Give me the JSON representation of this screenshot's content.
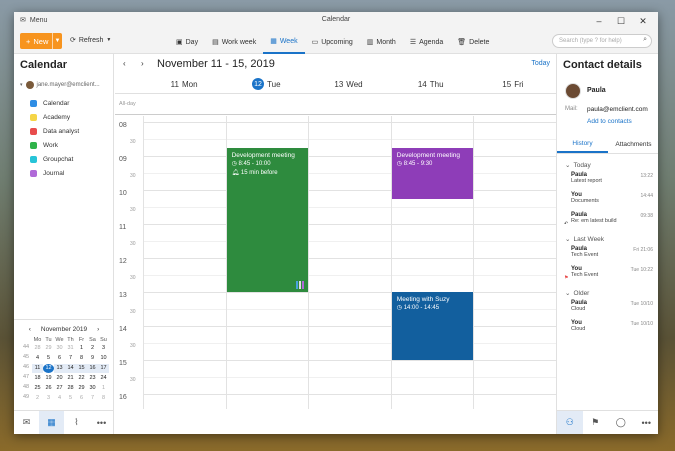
{
  "window": {
    "menu_label": "Menu",
    "title": "Calendar"
  },
  "toolbar": {
    "new_label": "New",
    "refresh_label": "Refresh",
    "views": [
      {
        "label": "Day",
        "icon": "calendar-day-icon",
        "active": false
      },
      {
        "label": "Work week",
        "icon": "calendar-workweek-icon",
        "active": false
      },
      {
        "label": "Week",
        "icon": "calendar-week-icon",
        "active": true
      },
      {
        "label": "Upcoming",
        "icon": "calendar-upcoming-icon",
        "active": false
      },
      {
        "label": "Month",
        "icon": "calendar-month-icon",
        "active": false
      },
      {
        "label": "Agenda",
        "icon": "agenda-icon",
        "active": false
      },
      {
        "label": "Delete",
        "icon": "trash-icon",
        "active": false
      }
    ],
    "search_placeholder": "Search (type ? for help)"
  },
  "sidebar": {
    "title": "Calendar",
    "account": "jane.mayer@emclient...",
    "calendars": [
      {
        "label": "Calendar",
        "color": "#2f8de4"
      },
      {
        "label": "Academy",
        "color": "#f5d547"
      },
      {
        "label": "Data analyst",
        "color": "#e84c4c"
      },
      {
        "label": "Work",
        "color": "#2fb34a"
      },
      {
        "label": "Groupchat",
        "color": "#27c4d8"
      },
      {
        "label": "Journal",
        "color": "#b06ad8"
      }
    ],
    "mini_calendar": {
      "month": "November 2019",
      "day_headers": [
        "Mo",
        "Tu",
        "We",
        "Th",
        "Fr",
        "Sa",
        "Su"
      ],
      "weeks": [
        {
          "wk": "44",
          "days": [
            "28",
            "29",
            "30",
            "31",
            "1",
            "2",
            "3"
          ]
        },
        {
          "wk": "45",
          "days": [
            "4",
            "5",
            "6",
            "7",
            "8",
            "9",
            "10"
          ]
        },
        {
          "wk": "46",
          "days": [
            "11",
            "12",
            "13",
            "14",
            "15",
            "16",
            "17"
          ]
        },
        {
          "wk": "47",
          "days": [
            "18",
            "19",
            "20",
            "21",
            "22",
            "23",
            "24"
          ]
        },
        {
          "wk": "48",
          "days": [
            "25",
            "26",
            "27",
            "28",
            "29",
            "30",
            "1"
          ]
        },
        {
          "wk": "49",
          "days": [
            "2",
            "3",
            "4",
            "5",
            "6",
            "7",
            "8"
          ]
        }
      ],
      "today": "12"
    }
  },
  "calendar": {
    "range_title": "November 11 - 15, 2019",
    "today_label": "Today",
    "all_day_label": "All-day",
    "days": [
      {
        "num": "11",
        "name": "Mon",
        "today": false
      },
      {
        "num": "12",
        "name": "Tue",
        "today": true
      },
      {
        "num": "13",
        "name": "Wed",
        "today": false
      },
      {
        "num": "14",
        "name": "Thu",
        "today": false
      },
      {
        "num": "15",
        "name": "Fri",
        "today": false
      }
    ],
    "hours": [
      "08",
      "09",
      "10",
      "11",
      "12",
      "13",
      "14",
      "15",
      "16"
    ],
    "half_label": "30",
    "events": [
      {
        "title": "Development meeting",
        "time": "8:45 - 10:00",
        "reminder": "15 min before",
        "color": "#2e8b3e",
        "day": 1,
        "start": 8.75,
        "end": 13.0,
        "tags": [
          "#4aa3df",
          "#e0e0e0",
          "#b06ad8"
        ]
      },
      {
        "title": "Development meeting",
        "time": "8:45 - 9:30",
        "reminder": "",
        "color": "#8e3db8",
        "day": 3,
        "start": 8.75,
        "end": 10.25,
        "tags": []
      },
      {
        "title": "Meeting with Suzy",
        "time": "14:00 - 14:45",
        "reminder": "",
        "color": "#125f9e",
        "day": 3,
        "start": 13.0,
        "end": 15.0,
        "tags": []
      }
    ]
  },
  "contact": {
    "title": "Contact details",
    "name": "Paula",
    "mail_label": "Mail:",
    "mail": "paula@emclient.com",
    "add_label": "Add to contacts",
    "tabs": [
      "History",
      "Attachments"
    ],
    "groups": [
      {
        "label": "Today",
        "items": [
          {
            "who": "Paula",
            "what": "Latest report",
            "when": "13:22",
            "mark": ""
          },
          {
            "who": "You",
            "what": "Documents",
            "when": "14:44",
            "mark": ""
          },
          {
            "who": "Paula",
            "what": "Re: em latest build",
            "when": "09:38",
            "mark": "reply"
          }
        ]
      },
      {
        "label": "Last Week",
        "items": [
          {
            "who": "Paula",
            "what": "Tech Event",
            "when": "Fri 21:06",
            "mark": ""
          },
          {
            "who": "You",
            "what": "Tech Event",
            "when": "Tue 10:22",
            "mark": "flag"
          }
        ]
      },
      {
        "label": "Older",
        "items": [
          {
            "who": "Paula",
            "what": "Cloud",
            "when": "Tue 10/10",
            "mark": ""
          },
          {
            "who": "You",
            "what": "Cloud",
            "when": "Tue 10/10",
            "mark": ""
          }
        ]
      }
    ]
  }
}
